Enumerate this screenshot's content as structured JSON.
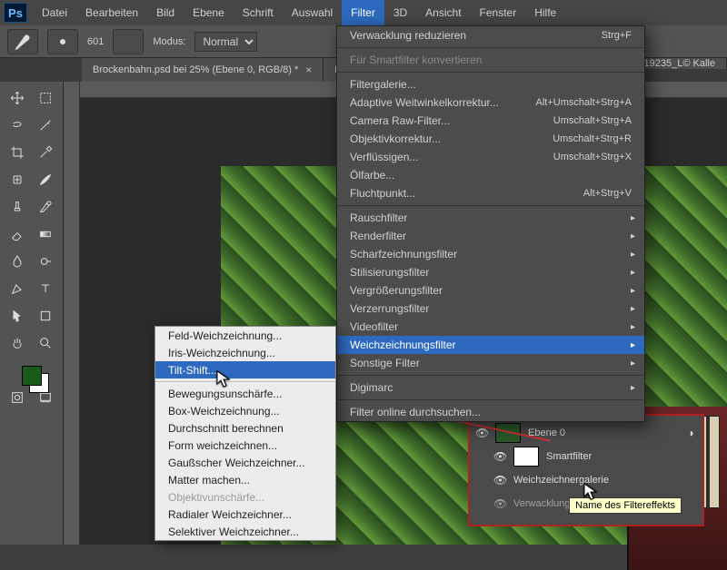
{
  "app": {
    "logo": "Ps"
  },
  "menubar": {
    "items": [
      "Datei",
      "Bearbeiten",
      "Bild",
      "Ebene",
      "Schrift",
      "Auswahl",
      "Filter",
      "3D",
      "Ansicht",
      "Fenster",
      "Hilfe"
    ],
    "active_index": 6
  },
  "optbar": {
    "brush_size": "601",
    "mode_label": "Modus:",
    "mode_value": "Normal"
  },
  "doctabs": [
    {
      "title": "Brockenbahn.psd bei 25% (Ebene 0, RGB/8) *"
    },
    {
      "title": "Fo…"
    },
    {
      "title": "…19235_L© Kalle"
    }
  ],
  "filter_menu": {
    "top": [
      {
        "label": "Verwacklung reduzieren",
        "kb": "Strg+F"
      },
      {
        "label": "Für Smartfilter konvertieren",
        "dim": true
      }
    ],
    "group1": [
      {
        "label": "Filtergalerie..."
      },
      {
        "label": "Adaptive Weitwinkelkorrektur...",
        "kb": "Alt+Umschalt+Strg+A"
      },
      {
        "label": "Camera Raw-Filter...",
        "kb": "Umschalt+Strg+A"
      },
      {
        "label": "Objektivkorrektur...",
        "kb": "Umschalt+Strg+R"
      },
      {
        "label": "Verflüssigen...",
        "kb": "Umschalt+Strg+X"
      },
      {
        "label": "Ölfarbe..."
      },
      {
        "label": "Fluchtpunkt...",
        "kb": "Alt+Strg+V"
      }
    ],
    "group2": [
      {
        "label": "Rauschfilter",
        "sub": true
      },
      {
        "label": "Renderfilter",
        "sub": true
      },
      {
        "label": "Scharfzeichnungsfilter",
        "sub": true
      },
      {
        "label": "Stilisierungsfilter",
        "sub": true
      },
      {
        "label": "Vergrößerungsfilter",
        "sub": true
      },
      {
        "label": "Verzerrungsfilter",
        "sub": true
      },
      {
        "label": "Videofilter",
        "sub": true
      },
      {
        "label": "Weichzeichnungsfilter",
        "sub": true,
        "hover": true
      },
      {
        "label": "Sonstige Filter",
        "sub": true
      }
    ],
    "group3": [
      {
        "label": "Digimarc",
        "sub": true
      }
    ],
    "group4": [
      {
        "label": "Filter online durchsuchen..."
      }
    ]
  },
  "submenu": {
    "top": [
      {
        "label": "Feld-Weichzeichnung..."
      },
      {
        "label": "Iris-Weichzeichnung..."
      },
      {
        "label": "Tilt-Shift...",
        "hl": true
      }
    ],
    "rest": [
      {
        "label": "Bewegungsunschärfe..."
      },
      {
        "label": "Box-Weichzeichnung..."
      },
      {
        "label": "Durchschnitt berechnen"
      },
      {
        "label": "Form weichzeichnen..."
      },
      {
        "label": "Gaußscher Weichzeichner..."
      },
      {
        "label": "Matter machen..."
      },
      {
        "label": "Objektivunschärfe...",
        "dim": true
      },
      {
        "label": "Radialer Weichzeichner..."
      },
      {
        "label": "Selektiver Weichzeichner..."
      }
    ]
  },
  "layers": {
    "row0": "Ebene 0",
    "row1": "Smartfilter",
    "row2": "Weichzeichnergalerie",
    "row3": "Verwacklung reduzieren"
  },
  "tooltip": "Name des Filtereffekts",
  "tool_names": [
    "move",
    "marquee",
    "lasso",
    "magic-wand",
    "crop",
    "eyedropper",
    "healing",
    "brush",
    "stamp",
    "history-brush",
    "eraser",
    "gradient",
    "blur",
    "dodge",
    "pen",
    "type",
    "path-select",
    "rectangle",
    "hand",
    "zoom"
  ]
}
